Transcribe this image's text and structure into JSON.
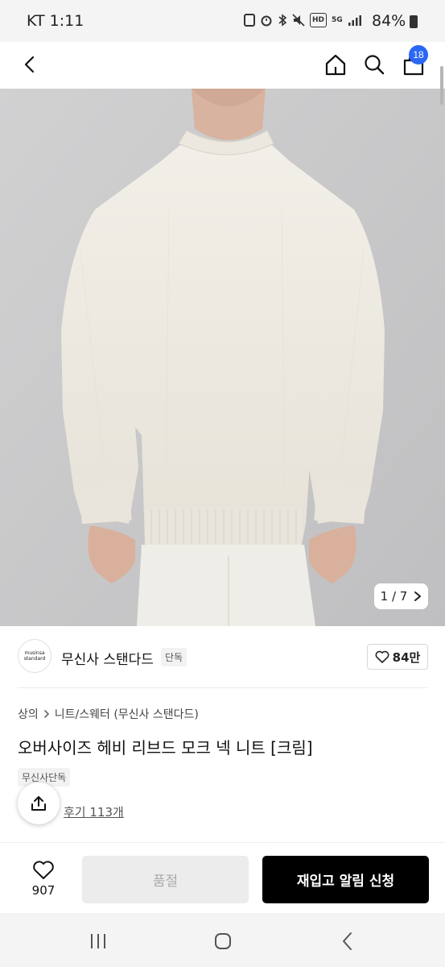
{
  "status_bar": {
    "time": "KT 1:11",
    "hd_label": "HD",
    "network_label": "5G",
    "battery": "84%"
  },
  "nav": {
    "cart_count": "18"
  },
  "gallery": {
    "counter": "1 / 7"
  },
  "brand": {
    "logo_line1": "musinsa",
    "logo_line2": "standard",
    "name": "무신사 스탠다드",
    "tag": "단독",
    "likes": "84만"
  },
  "product": {
    "breadcrumb_category": "상의",
    "breadcrumb_sub": "니트/스웨터 (무신사 스탠다드)",
    "title": "오버사이즈 헤비 리브드 모크 넥 니트 [크림]",
    "exclusive_label": "무신사단독",
    "review_text": "후기 113개"
  },
  "bottom_bar": {
    "wish_count": "907",
    "soldout_label": "품절",
    "restock_label": "재입고 알림 신청"
  },
  "colors": {
    "accent_blue": "#2a67f5",
    "photo_background": "#c8c8c9",
    "sweater_cream": "#efece4"
  }
}
